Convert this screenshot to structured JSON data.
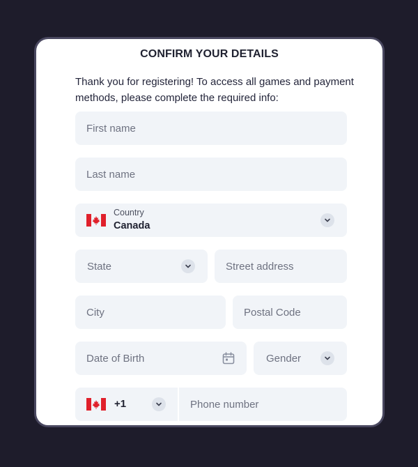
{
  "form": {
    "title": "CONFIRM YOUR DETAILS",
    "intro": "Thank you for registering! To access all games and payment methods, please complete the required info:",
    "first_name_placeholder": "First name",
    "last_name_placeholder": "Last name",
    "country_label": "Country",
    "country_value": "Canada",
    "state_placeholder": "State",
    "street_placeholder": "Street address",
    "city_placeholder": "City",
    "postal_placeholder": "Postal Code",
    "dob_placeholder": "Date of Birth",
    "gender_placeholder": "Gender",
    "phone_code": "+1",
    "phone_placeholder": "Phone number"
  },
  "icons": {
    "flag": "canada-flag-icon",
    "chevron": "chevron-down-icon",
    "calendar": "calendar-icon"
  },
  "colors": {
    "background": "#1e1c2b",
    "card": "#ffffff",
    "field": "#f1f4f8",
    "flag_red": "#e0202b"
  }
}
